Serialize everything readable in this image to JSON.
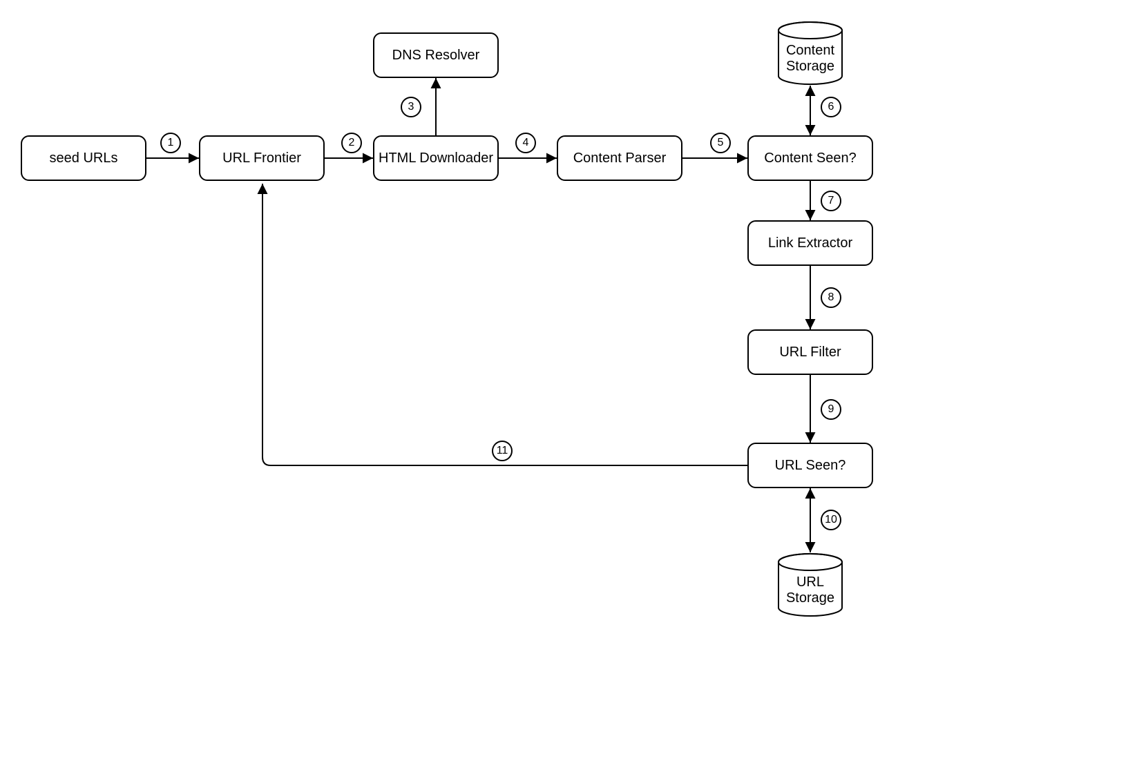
{
  "nodes": {
    "seed": {
      "label": "seed URLs"
    },
    "frontier": {
      "label": "URL Frontier"
    },
    "downloader": {
      "label": "HTML Downloader"
    },
    "dns": {
      "label": "DNS Resolver"
    },
    "parser": {
      "label": "Content Parser"
    },
    "contentSeen": {
      "label": "Content Seen?"
    },
    "linkExtract": {
      "label": "Link Extractor"
    },
    "urlFilter": {
      "label": "URL Filter"
    },
    "urlSeen": {
      "label": "URL Seen?"
    }
  },
  "stores": {
    "contentStorage": {
      "line1": "Content",
      "line2": "Storage"
    },
    "urlStorage": {
      "line1": "URL",
      "line2": "Storage"
    }
  },
  "edges": {
    "e1": {
      "num": "1"
    },
    "e2": {
      "num": "2"
    },
    "e3": {
      "num": "3"
    },
    "e4": {
      "num": "4"
    },
    "e5": {
      "num": "5"
    },
    "e6": {
      "num": "6"
    },
    "e7": {
      "num": "7"
    },
    "e8": {
      "num": "8"
    },
    "e9": {
      "num": "9"
    },
    "e10": {
      "num": "10"
    },
    "e11": {
      "num": "11"
    }
  }
}
